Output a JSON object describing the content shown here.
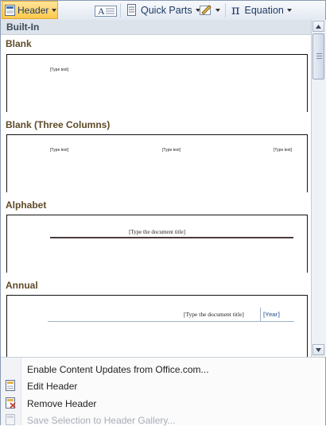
{
  "ribbon": {
    "header_label": "Header",
    "quick_parts_label": "Quick Parts",
    "equation_label": "Equation",
    "equation_symbol": "π"
  },
  "gallery": {
    "group_label": "Built-In",
    "sections": [
      {
        "title": "Blank",
        "placeholders": [
          "[Type text]"
        ]
      },
      {
        "title": "Blank (Three Columns)",
        "placeholders": [
          "[Type text]",
          "[Type text]",
          "[Type text]"
        ]
      },
      {
        "title": "Alphabet",
        "placeholders": [
          "[Type the document title]"
        ]
      },
      {
        "title": "Annual",
        "placeholders": [
          "[Type the document title]",
          "[Year]"
        ]
      }
    ]
  },
  "menu": {
    "items": [
      {
        "label": "Enable Content Updates from Office.com...",
        "enabled": true,
        "icon": "none"
      },
      {
        "label": "Edit Header",
        "enabled": true,
        "icon": "edit-header-icon"
      },
      {
        "label": "Remove Header",
        "enabled": true,
        "icon": "remove-header-icon"
      },
      {
        "label": "Save Selection to Header Gallery...",
        "enabled": false,
        "icon": "save-selection-icon"
      }
    ]
  },
  "colors": {
    "header_button": "#ffc94a",
    "section_title": "#5e4a27",
    "alphabet_rule": "#4a3b3b",
    "annual_rule": "#9fb3c8",
    "year_text": "#5b7aa6",
    "disabled_text": "#a7aeb8"
  }
}
